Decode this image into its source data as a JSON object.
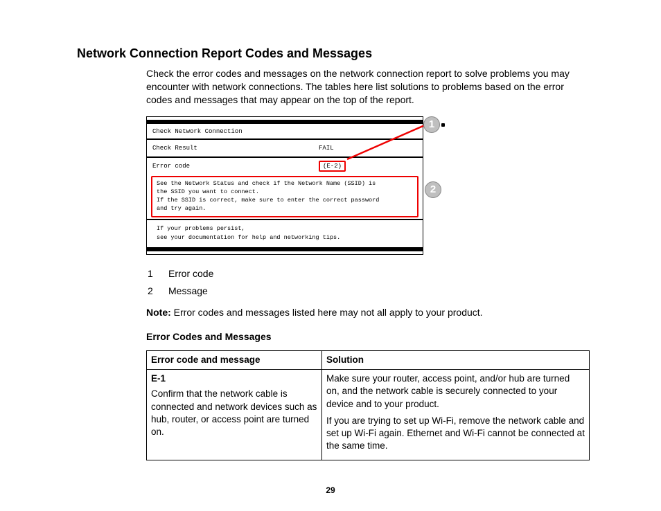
{
  "title": "Network Connection Report Codes and Messages",
  "intro": "Check the error codes and messages on the network connection report to solve problems you may encounter with network connections. The tables here list solutions to problems based on the error codes and messages that may appear on the top of the report.",
  "diagram": {
    "heading": "Check Network Connection",
    "check_result_label": "Check Result",
    "check_result_value": "FAIL",
    "error_code_label": "Error code",
    "error_code_value": "(E-2)",
    "message_line1": "See the Network Status and check if the Network Name (SSID) is",
    "message_line2": "the SSID you want to connect.",
    "message_line3": "If the SSID is correct, make sure to enter the correct password",
    "message_line4": "and try again.",
    "tips_line1": "If your problems persist,",
    "tips_line2": "see your documentation for help and networking tips.",
    "callout1": "1",
    "callout2": "2"
  },
  "legend": {
    "num1": "1",
    "label1": "Error code",
    "num2": "2",
    "label2": "Message"
  },
  "note_label": "Note:",
  "note_text": " Error codes and messages listed here may not all apply to your product.",
  "subheading": "Error Codes and Messages",
  "table": {
    "header_left": "Error code and message",
    "header_right": "Solution",
    "row1": {
      "code": "E-1",
      "desc": "Confirm that the network cable is connected and network devices such as hub, router, or access point are turned on.",
      "sol1": "Make sure your router, access point, and/or hub are turned on, and the network cable is securely connected to your device and to your product.",
      "sol2": "If you are trying to set up Wi-Fi, remove the network cable and set up Wi-Fi again. Ethernet and Wi-Fi cannot be connected at the same time."
    }
  },
  "page_number": "29"
}
